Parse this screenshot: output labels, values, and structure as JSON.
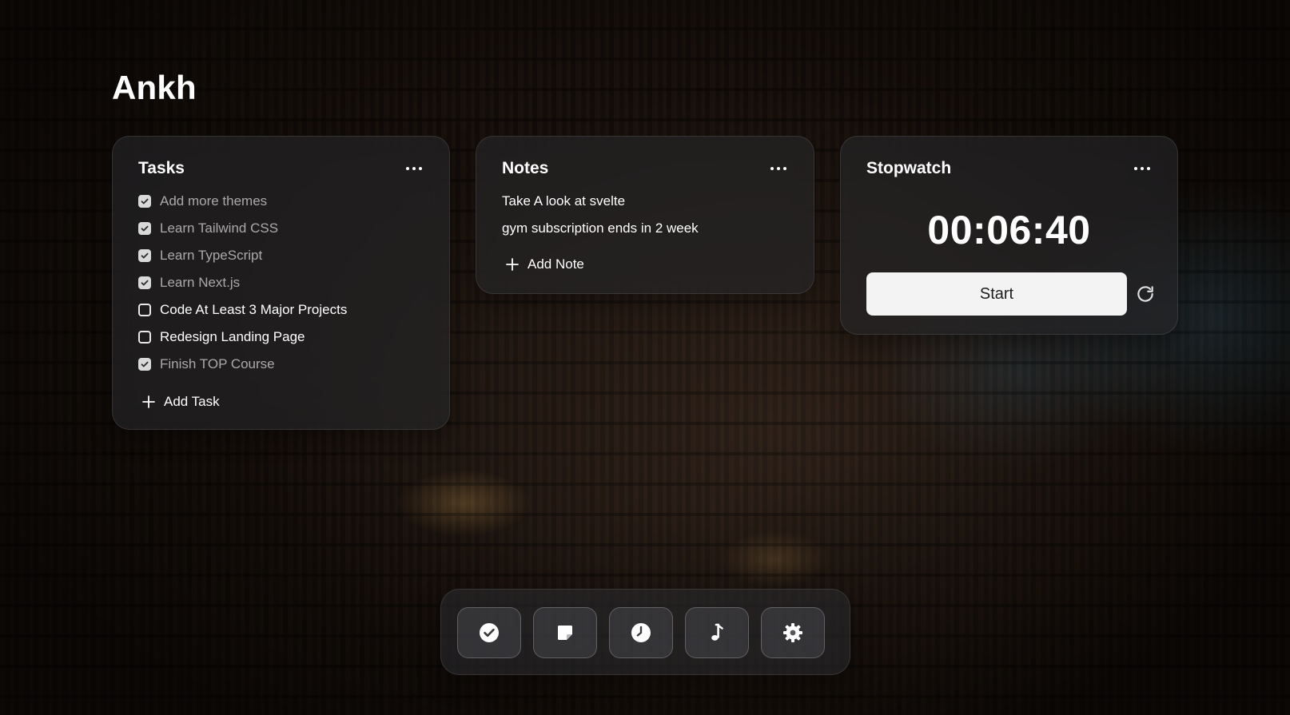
{
  "app": {
    "title": "Ankh"
  },
  "tasks": {
    "title": "Tasks",
    "menu_icon": "more-horizontal-icon",
    "items": [
      {
        "label": "Add more themes",
        "checked": true
      },
      {
        "label": "Learn Tailwind CSS",
        "checked": true
      },
      {
        "label": "Learn TypeScript",
        "checked": true
      },
      {
        "label": "Learn Next.js",
        "checked": true
      },
      {
        "label": "Code At Least 3 Major Projects",
        "checked": false
      },
      {
        "label": "Redesign Landing Page",
        "checked": false
      },
      {
        "label": "Finish TOP Course",
        "checked": true
      }
    ],
    "add_label": "Add Task"
  },
  "notes": {
    "title": "Notes",
    "menu_icon": "more-horizontal-icon",
    "items": [
      "Take A look at svelte",
      "gym subscription ends in 2 week"
    ],
    "add_label": "Add Note"
  },
  "stopwatch": {
    "title": "Stopwatch",
    "menu_icon": "more-horizontal-icon",
    "time": "00:06:40",
    "start_label": "Start",
    "reset_icon": "refresh-icon"
  },
  "dock": {
    "items": [
      {
        "icon": "check-circle-icon"
      },
      {
        "icon": "sticky-note-icon"
      },
      {
        "icon": "clock-icon"
      },
      {
        "icon": "music-note-icon"
      },
      {
        "icon": "gear-icon"
      }
    ]
  },
  "colors": {
    "card_bg": "#26262a",
    "button_bg": "#f3f3f3",
    "text": "#ffffff"
  }
}
